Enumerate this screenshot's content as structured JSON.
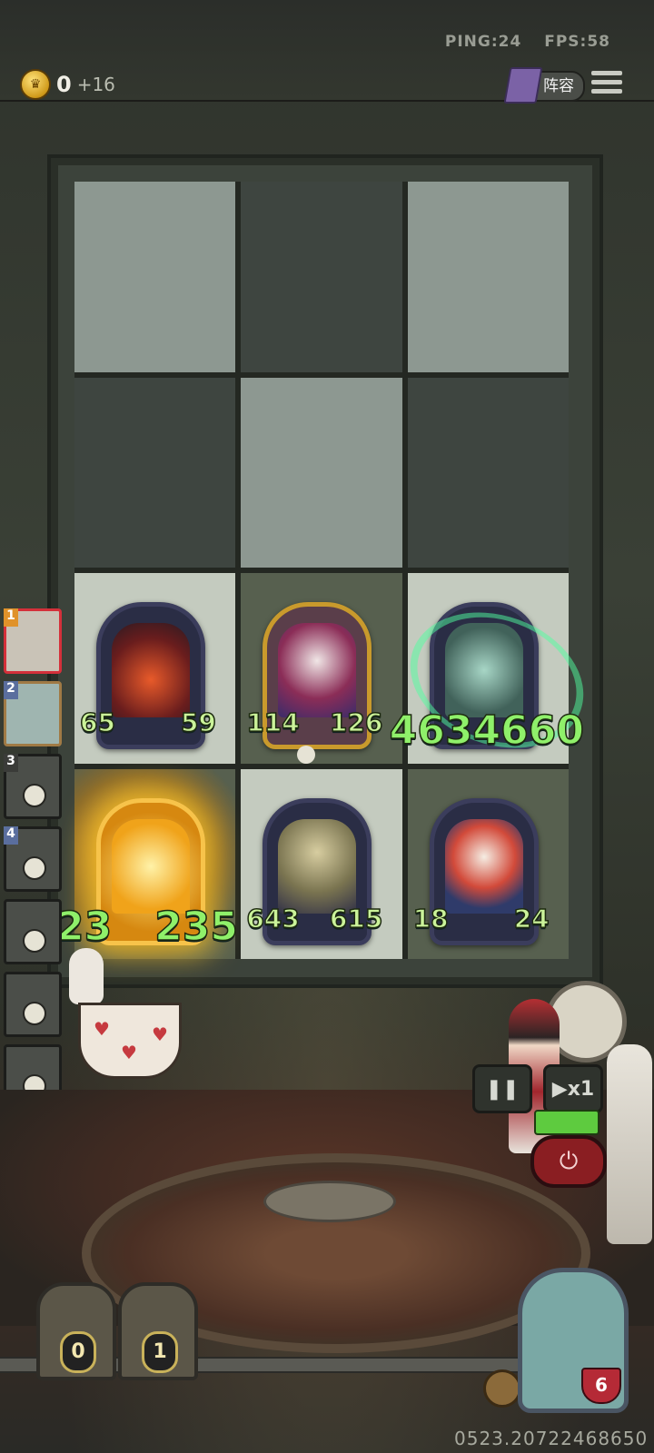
{
  "status": {
    "ping": "PING:24",
    "fps": "FPS:58"
  },
  "currency": {
    "gold": "0",
    "income": "+16"
  },
  "header": {
    "lineup_label": "阵容"
  },
  "board": {
    "cards": [
      {
        "attack": "65",
        "health": "59"
      },
      {
        "attack": "114",
        "health": "126"
      },
      {
        "attack": "46346",
        "health": "60"
      },
      {
        "attack": "23",
        "health": "235"
      },
      {
        "attack": "643",
        "health": "615"
      },
      {
        "attack": "18",
        "health": "24"
      }
    ]
  },
  "heroes": [
    {
      "rank": "1"
    },
    {
      "rank": "2"
    },
    {
      "rank": "3"
    },
    {
      "rank": "4"
    },
    {
      "rank": ""
    },
    {
      "rank": ""
    },
    {
      "rank": ""
    },
    {
      "rank": ""
    }
  ],
  "controls": {
    "speed_label": "▶x1",
    "pause_label": "❚❚",
    "power_label": "⏻"
  },
  "chests": [
    "0",
    "1"
  ],
  "player": {
    "health": "6"
  },
  "build_id": "0523.20722468650"
}
